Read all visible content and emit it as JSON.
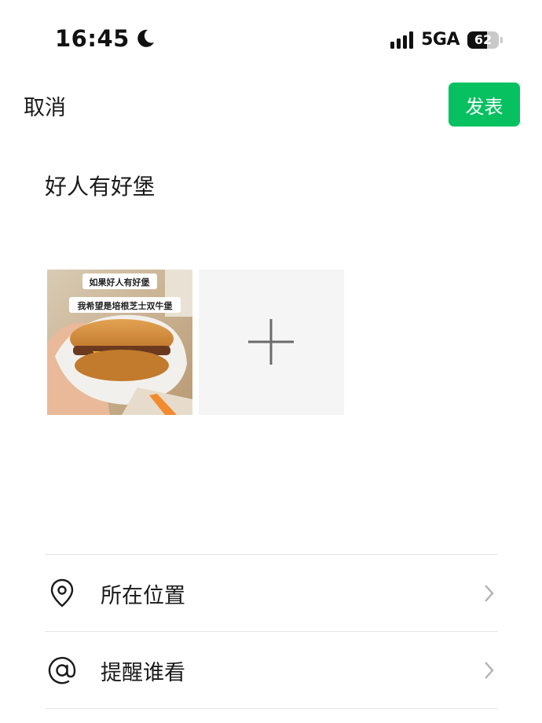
{
  "status_bar": {
    "time": "16:45",
    "network": "5GA",
    "battery": "62",
    "battery_level": 0.62,
    "signal_bars": 4,
    "icons": [
      "moon-icon",
      "signal-icon",
      "battery-icon"
    ]
  },
  "header": {
    "cancel_label": "取消",
    "publish_label": "发表",
    "accent_color": "#07c160"
  },
  "post": {
    "text": "好人有好堡",
    "image": {
      "caption_line1": "如果好人有好堡",
      "caption_line2": "我希望是培根芝士双牛堡"
    },
    "add_icon": "plus-icon"
  },
  "options": [
    {
      "label": "所在位置",
      "icon": "location-pin-icon"
    },
    {
      "label": "提醒谁看",
      "icon": "at-sign-icon"
    }
  ]
}
